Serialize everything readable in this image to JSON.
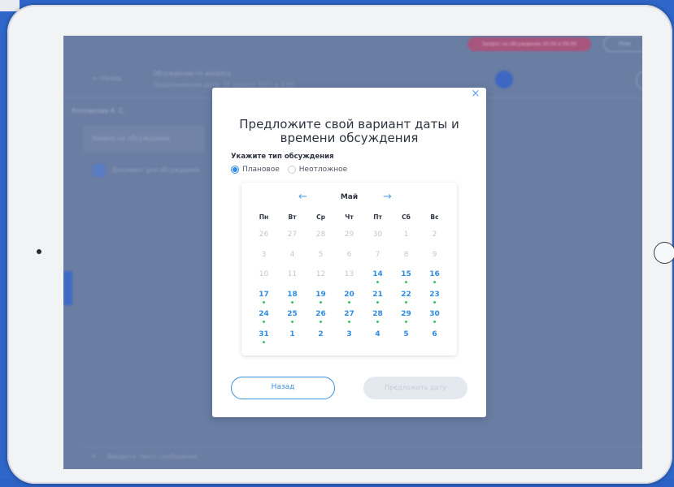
{
  "background": {
    "notice_pill_text": "Запрос на обсуждение 20.04 в 09:00",
    "help_pill_text": "Пом",
    "back_link": "← Назад",
    "topic_title": "Обсуждение по вопросу",
    "topic_subtitle": "Предложенная дата: 20 апреля 2021 в 9:00",
    "author": "Колпакова А. С.",
    "request_card": "Заявка на обсуждение",
    "attachment": "Документ для обсуждения",
    "message_placeholder": "Введите текст сообщения"
  },
  "modal": {
    "title": "Предложите свой вариант даты и времени обсуждения",
    "close_symbol": "×",
    "type_label": "Укажите тип обсуждения",
    "options": [
      {
        "label": "Плановое",
        "selected": true
      },
      {
        "label": "Неотложное",
        "selected": false
      }
    ],
    "calendar": {
      "month": "Май",
      "prev_arrow": "←",
      "next_arrow": "→",
      "weekdays": [
        "Пн",
        "Вт",
        "Ср",
        "Чт",
        "Пт",
        "Сб",
        "Вс"
      ],
      "weeks": [
        [
          {
            "d": "26",
            "s": "off"
          },
          {
            "d": "27",
            "s": "off"
          },
          {
            "d": "28",
            "s": "off"
          },
          {
            "d": "29",
            "s": "off"
          },
          {
            "d": "30",
            "s": "off"
          },
          {
            "d": "1",
            "s": "off"
          },
          {
            "d": "2",
            "s": "off"
          }
        ],
        [
          {
            "d": "3",
            "s": "off"
          },
          {
            "d": "4",
            "s": "off"
          },
          {
            "d": "5",
            "s": "off"
          },
          {
            "d": "6",
            "s": "off"
          },
          {
            "d": "7",
            "s": "off"
          },
          {
            "d": "8",
            "s": "off"
          },
          {
            "d": "9",
            "s": "off"
          }
        ],
        [
          {
            "d": "10",
            "s": "off"
          },
          {
            "d": "11",
            "s": "off"
          },
          {
            "d": "12",
            "s": "off"
          },
          {
            "d": "13",
            "s": "off"
          },
          {
            "d": "14",
            "s": "dot"
          },
          {
            "d": "15",
            "s": "dot"
          },
          {
            "d": "16",
            "s": "dot"
          }
        ],
        [
          {
            "d": "17",
            "s": "dot"
          },
          {
            "d": "18",
            "s": "dot"
          },
          {
            "d": "19",
            "s": "dot"
          },
          {
            "d": "20",
            "s": "dot"
          },
          {
            "d": "21",
            "s": "dot"
          },
          {
            "d": "22",
            "s": "dot"
          },
          {
            "d": "23",
            "s": "dot"
          }
        ],
        [
          {
            "d": "24",
            "s": "dot"
          },
          {
            "d": "25",
            "s": "dot"
          },
          {
            "d": "26",
            "s": "dot"
          },
          {
            "d": "27",
            "s": "dot"
          },
          {
            "d": "28",
            "s": "dot"
          },
          {
            "d": "29",
            "s": "dot"
          },
          {
            "d": "30",
            "s": "dot"
          }
        ],
        [
          {
            "d": "31",
            "s": "dot"
          },
          {
            "d": "1",
            "s": "avail"
          },
          {
            "d": "2",
            "s": "avail"
          },
          {
            "d": "3",
            "s": "avail"
          },
          {
            "d": "4",
            "s": "avail"
          },
          {
            "d": "5",
            "s": "avail"
          },
          {
            "d": "6",
            "s": "avail"
          }
        ]
      ]
    },
    "back_button": "Назад",
    "propose_button": "Предложить дату"
  },
  "colors": {
    "accent": "#2f8ce0",
    "available_dot": "#3cc26a",
    "overlay": "#6a7da3"
  }
}
